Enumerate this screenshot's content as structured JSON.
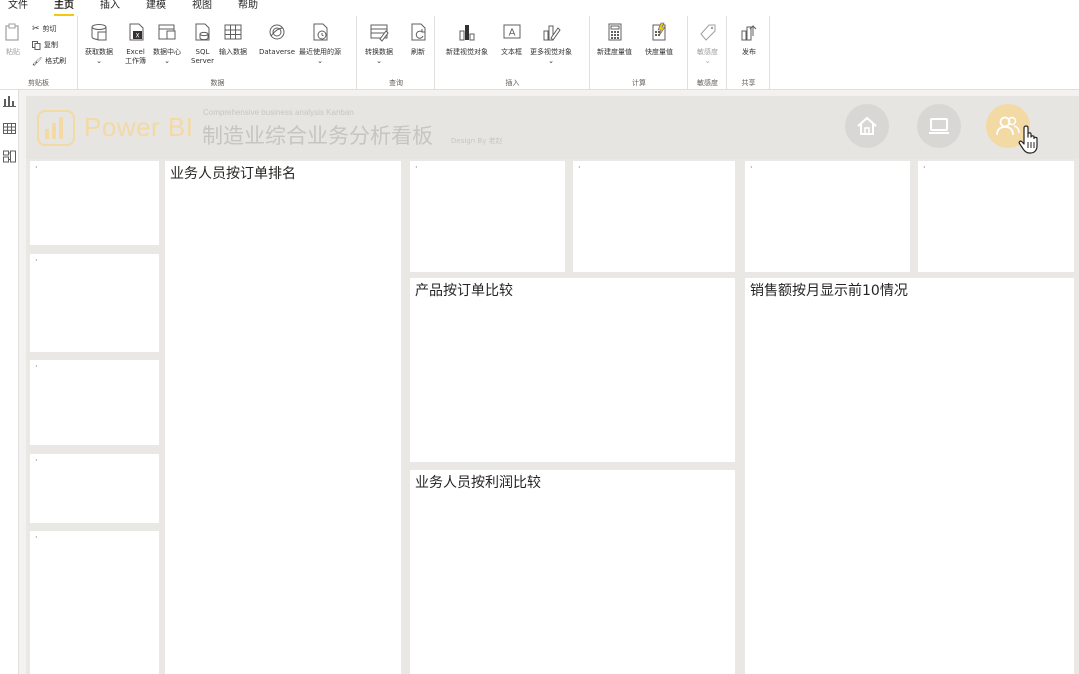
{
  "menu": {
    "tabs": [
      "文件",
      "主页",
      "插入",
      "建模",
      "视图",
      "帮助"
    ],
    "active": "主页"
  },
  "ribbon": {
    "clipboard": {
      "paste": "粘贴",
      "cut": "剪切",
      "copy": "复制",
      "format_painter": "格式刷",
      "label": "剪贴板"
    },
    "data": {
      "get_data": "获取数据",
      "excel_line1": "Excel",
      "excel_line2": "工作簿",
      "data_hub": "数据中心",
      "sql_line1": "SQL",
      "sql_line2": "Server",
      "enter_data": "输入数据",
      "dataverse": "Dataverse",
      "recent_sources": "最近使用的源",
      "label": "数据"
    },
    "queries": {
      "transform": "转换数据",
      "refresh": "刷新",
      "label": "查询"
    },
    "insert": {
      "new_visual": "新建视觉对象",
      "text_box": "文本框",
      "more_visuals": "更多视觉对象",
      "label": "插入"
    },
    "calculations": {
      "new_measure": "新建度量值",
      "quick_measure": "快度量值",
      "label": "计算"
    },
    "sensitivity": {
      "sensitivity": "敏感度",
      "label": "敏感度"
    },
    "share": {
      "publish": "发布",
      "label": "共享"
    }
  },
  "canvas": {
    "logo_text": "Power BI",
    "subtitle_en": "Comprehensive business analysis Kanban",
    "title_cn": "制造业综合业务分析看板",
    "design_by": "Design By 老赵",
    "tiles": {
      "sales_rank": "业务人员按订单排名",
      "product_orders": "产品按订单比较",
      "monthly_sales": "销售额按月显示前10情况",
      "profit_compare": "业务人员按利润比较",
      "placeholder_dot": "·"
    }
  },
  "colors": {
    "accent": "#f2c811",
    "logo": "#f3d9a3",
    "canvas_bg": "#e9e8e4"
  }
}
